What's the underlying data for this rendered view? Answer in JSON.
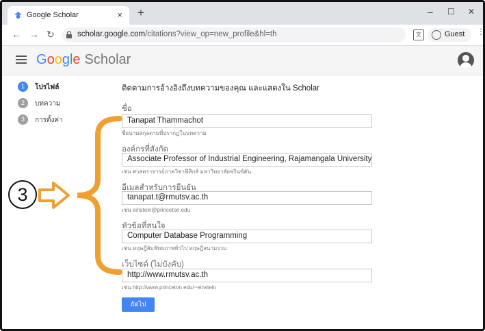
{
  "browser": {
    "tab_title": "Google Scholar",
    "tab_close": "×",
    "new_tab": "+",
    "win_minimize": "–",
    "win_maximize": "☐",
    "win_close": "✕",
    "url_host": "scholar.google.com",
    "url_path": "/citations?view_op=new_profile&hl=th",
    "guest_label": "Guest"
  },
  "header": {
    "logo_letters": [
      "G",
      "o",
      "o",
      "g",
      "l",
      "e"
    ],
    "logo_suffix": "Scholar"
  },
  "steps": [
    {
      "num": "1",
      "label": "โปรไฟล์",
      "active": true
    },
    {
      "num": "2",
      "label": "บทความ",
      "active": false
    },
    {
      "num": "3",
      "label": "การตั้งค่า",
      "active": false
    }
  ],
  "form": {
    "intro": "ติดตามการอ้างอิงถึงบทความของคุณ และแสดงใน Scholar",
    "fields": [
      {
        "label": "ชื่อ",
        "value": "Tanapat Thammachot",
        "hint": "ชื่อนามสกุลตามที่ปรากฏในบทความ"
      },
      {
        "label": "องค์กรที่สังกัด",
        "value": "Associate Professor of Industrial Engineering, Rajamangala University of Te",
        "hint": "เช่น ศาสตราจารย์ภาควิชาฟิสิกส์ มหาวิทยาลัยพรินซ์ตัน"
      },
      {
        "label": "อีเมลสำหรับการยืนยัน",
        "value": "tanapat.t@rmutsv.ac.th",
        "hint": "เช่น einstein@princeton.edu"
      },
      {
        "label": "หัวข้อที่สนใจ",
        "value": "Computer Database Programming",
        "hint": "เช่น ทฤษฎีสัมพัทธภาพทั่วไป ทฤษฎีสนามรวม"
      },
      {
        "label": "เว็บไซต์ (ไม่บังคับ)",
        "value": "http://www.rmutsv.ac.th",
        "hint": "เช่น http://www.princeton.edu/~einstein"
      }
    ],
    "next_label": "ถัดไป"
  },
  "annotation": {
    "step_number": "3",
    "color": "#f0a030"
  }
}
